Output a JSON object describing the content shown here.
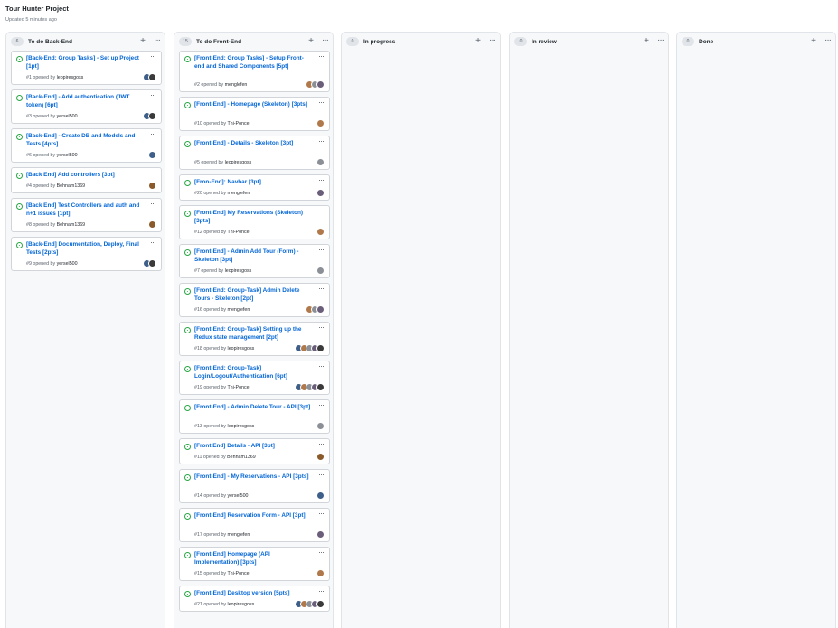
{
  "project": {
    "title": "Tour Hunter Project",
    "updated": "Updated 5 minutes ago"
  },
  "palette": {
    "blue": "#3d5f8a",
    "brown": "#8a5a2b",
    "gray": "#8b8f96",
    "dark": "#3a3a3a",
    "tan": "#b0794b",
    "purple": "#6b5e7a"
  },
  "columns": [
    {
      "count": "6",
      "name": "To do Back-End",
      "add_icon": "plus-icon",
      "menu_icon": "ellipsis-icon",
      "cards": [
        {
          "title": "[Back-End: Group Tasks] - Set up Project [1pt]",
          "number": "#1",
          "opened_by": "opened by",
          "author": "leopiresgoss",
          "avatars": [
            "blue",
            "dark"
          ]
        },
        {
          "title": "[Back-End] - Add authentication (JWT token) [6pt]",
          "number": "#3",
          "opened_by": "opened by",
          "author": "yersel500",
          "avatars": [
            "blue",
            "dark"
          ]
        },
        {
          "title": "[Back-End] - Create DB and Models and Tests [4pts]",
          "number": "#6",
          "opened_by": "opened by",
          "author": "yersel500",
          "avatars": [
            "blue"
          ]
        },
        {
          "title": "[Back End] Add controllers [3pt]",
          "number": "#4",
          "opened_by": "opened by",
          "author": "Behnam1369",
          "avatars": [
            "brown"
          ]
        },
        {
          "title": "[Back End] Test Controllers and auth and n+1 issues [1pt]",
          "number": "#8",
          "opened_by": "opened by",
          "author": "Behnam1369",
          "avatars": [
            "brown"
          ]
        },
        {
          "title": "[Back-End] Documentation, Deploy, Final Tests [2pts]",
          "number": "#9",
          "opened_by": "opened by",
          "author": "yersel500",
          "avatars": [
            "blue",
            "dark"
          ]
        }
      ]
    },
    {
      "count": "15",
      "name": "To do Front-End",
      "add_icon": "plus-icon",
      "menu_icon": "ellipsis-icon",
      "cards": [
        {
          "title": "[Front-End: Group Tasks] - Setup Front-end and Shared Components [5pt]",
          "number": "#2",
          "opened_by": "opened by",
          "author": "menglefen",
          "avatars": [
            "tan",
            "gray",
            "purple"
          ]
        },
        {
          "title": "[Front-End] - Homepage (Skeleton) [3pts]",
          "number": "#10",
          "opened_by": "opened by",
          "author": "Thi-Ponce",
          "avatars": [
            "tan"
          ]
        },
        {
          "title": "[Front-End] - Details - Skeleton [3pt]",
          "number": "#5",
          "opened_by": "opened by",
          "author": "leopiresgoss",
          "avatars": [
            "gray"
          ]
        },
        {
          "title": "[Fron-End]: Navbar [3pt]",
          "number": "#20",
          "opened_by": "opened by",
          "author": "menglefen",
          "avatars": [
            "purple"
          ]
        },
        {
          "title": "[Front-End] My Reservations (Skeleton) [3pts]",
          "number": "#12",
          "opened_by": "opened by",
          "author": "Thi-Ponce",
          "avatars": [
            "tan"
          ]
        },
        {
          "title": "[Front-End] - Admin Add Tour (Form) - Skeleton [3pt]",
          "number": "#7",
          "opened_by": "opened by",
          "author": "leopiresgoss",
          "avatars": [
            "gray"
          ]
        },
        {
          "title": "[Front-End: Group-Task] Admin Delete Tours - Skeleton [2pt]",
          "number": "#16",
          "opened_by": "opened by",
          "author": "menglefen",
          "avatars": [
            "tan",
            "gray",
            "purple"
          ]
        },
        {
          "title": "[Front-End: Group-Task] Setting up the Redux state management [2pt]",
          "number": "#18",
          "opened_by": "opened by",
          "author": "leopiresgoss",
          "avatars": [
            "blue",
            "tan",
            "gray",
            "purple",
            "dark"
          ]
        },
        {
          "title": "[Front-End: Group-Task] Login/Logout/Authentication [6pt]",
          "number": "#19",
          "opened_by": "opened by",
          "author": "Thi-Ponce",
          "avatars": [
            "blue",
            "tan",
            "gray",
            "purple",
            "dark"
          ]
        },
        {
          "title": "[Front-End] - Admin Delete Tour - API [3pt]",
          "number": "#13",
          "opened_by": "opened by",
          "author": "leopiresgoss",
          "avatars": [
            "gray"
          ]
        },
        {
          "title": "[Front End] Details - API [3pt]",
          "number": "#11",
          "opened_by": "opened by",
          "author": "Behnam1369",
          "avatars": [
            "brown"
          ]
        },
        {
          "title": "[Front-End] - My Reservations - API [3pts]",
          "number": "#14",
          "opened_by": "opened by",
          "author": "yersel500",
          "avatars": [
            "blue"
          ]
        },
        {
          "title": "[Front-End] Reservation Form - API [3pt]",
          "number": "#17",
          "opened_by": "opened by",
          "author": "menglefen",
          "avatars": [
            "purple"
          ]
        },
        {
          "title": "[Front-End] Homepage (API Implementation) [3pts]",
          "number": "#15",
          "opened_by": "opened by",
          "author": "Thi-Ponce",
          "avatars": [
            "tan"
          ]
        },
        {
          "title": "[Front-End] Desktop version [5pts]",
          "number": "#21",
          "opened_by": "opened by",
          "author": "leopiresgoss",
          "avatars": [
            "blue",
            "tan",
            "gray",
            "purple",
            "dark"
          ]
        }
      ]
    },
    {
      "count": "0",
      "name": "In progress",
      "add_icon": "plus-icon",
      "menu_icon": "ellipsis-icon",
      "cards": []
    },
    {
      "count": "0",
      "name": "In review",
      "add_icon": "plus-icon",
      "menu_icon": "ellipsis-icon",
      "cards": []
    },
    {
      "count": "0",
      "name": "Done",
      "add_icon": "plus-icon",
      "menu_icon": "ellipsis-icon",
      "cards": []
    }
  ]
}
